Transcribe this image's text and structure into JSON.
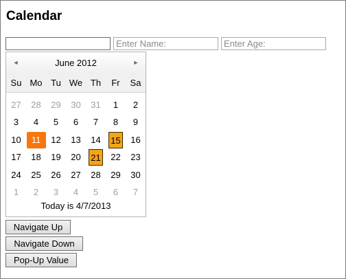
{
  "page": {
    "title": "Calendar"
  },
  "inputs": {
    "date_value": "",
    "name_placeholder": "Enter Name:",
    "age_placeholder": "Enter Age:"
  },
  "calendar": {
    "month_title": "June 2012",
    "prev_arrow": "◄",
    "next_arrow": "►",
    "weekdays": [
      "Su",
      "Mo",
      "Tu",
      "We",
      "Th",
      "Fr",
      "Sa"
    ],
    "weeks": [
      [
        {
          "d": "27",
          "o": true
        },
        {
          "d": "28",
          "o": true
        },
        {
          "d": "29",
          "o": true
        },
        {
          "d": "30",
          "o": true
        },
        {
          "d": "31",
          "o": true
        },
        {
          "d": "1"
        },
        {
          "d": "2"
        }
      ],
      [
        {
          "d": "3"
        },
        {
          "d": "4"
        },
        {
          "d": "5"
        },
        {
          "d": "6"
        },
        {
          "d": "7"
        },
        {
          "d": "8"
        },
        {
          "d": "9"
        }
      ],
      [
        {
          "d": "10"
        },
        {
          "d": "11",
          "s": "selected"
        },
        {
          "d": "12"
        },
        {
          "d": "13"
        },
        {
          "d": "14"
        },
        {
          "d": "15",
          "s": "highlight"
        },
        {
          "d": "16"
        }
      ],
      [
        {
          "d": "17"
        },
        {
          "d": "18"
        },
        {
          "d": "19"
        },
        {
          "d": "20"
        },
        {
          "d": "21",
          "s": "highlight"
        },
        {
          "d": "22"
        },
        {
          "d": "23"
        }
      ],
      [
        {
          "d": "24"
        },
        {
          "d": "25"
        },
        {
          "d": "26"
        },
        {
          "d": "27"
        },
        {
          "d": "28"
        },
        {
          "d": "29"
        },
        {
          "d": "30"
        }
      ],
      [
        {
          "d": "1",
          "o": true
        },
        {
          "d": "2",
          "o": true
        },
        {
          "d": "3",
          "o": true
        },
        {
          "d": "4",
          "o": true
        },
        {
          "d": "5",
          "o": true
        },
        {
          "d": "6",
          "o": true
        },
        {
          "d": "7",
          "o": true
        }
      ]
    ],
    "today_text": "Today is 4/7/2013"
  },
  "buttons": {
    "navigate_up": "Navigate Up",
    "navigate_down": "Navigate Down",
    "popup_value": "Pop-Up Value"
  },
  "colors": {
    "selected_day": "#f7760d",
    "highlighted_day": "#f5a31a"
  }
}
